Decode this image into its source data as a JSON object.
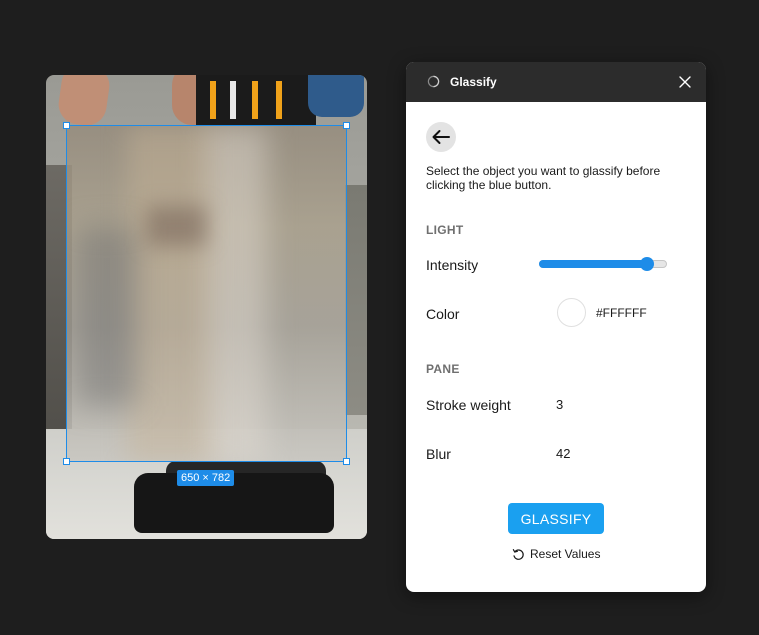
{
  "canvas": {
    "selection_size": "650 × 782"
  },
  "plugin": {
    "title": "Glassify",
    "icons": {
      "app": "glassify-logo-icon",
      "close": "close-icon",
      "back": "arrow-left-icon",
      "reset": "refresh-icon"
    },
    "description": "Select the object you want to glassify before clicking the blue button.",
    "light": {
      "section_label": "LIGHT",
      "intensity_label": "Intensity",
      "intensity_value": 0.84,
      "color_label": "Color",
      "color_hex": "#FFFFFF"
    },
    "pane": {
      "section_label": "PANE",
      "stroke_label": "Stroke weight",
      "stroke_value": "3",
      "blur_label": "Blur",
      "blur_value": "42"
    },
    "glassify_button": "GLASSIFY",
    "reset_label": "Reset Values"
  },
  "colors": {
    "accent": "#1E8CE8",
    "button": "#1AA0F0",
    "titlebar": "#2C2C2C",
    "background": "#1E1E1E"
  }
}
